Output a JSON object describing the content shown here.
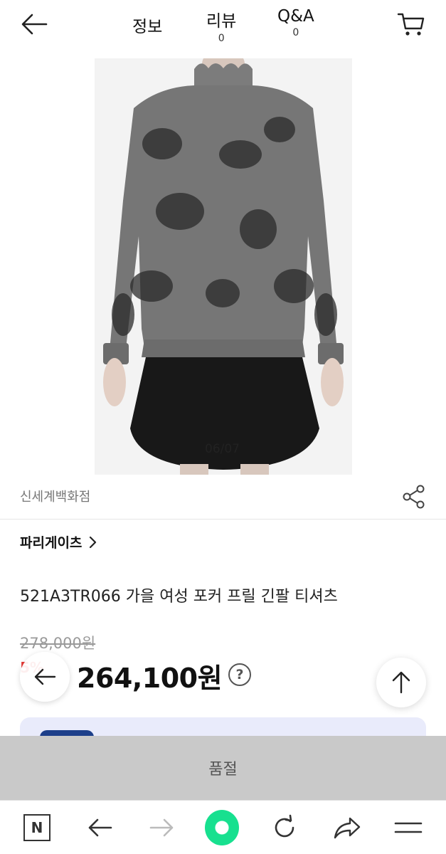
{
  "header": {
    "tabs": [
      {
        "label": "정보",
        "count": ""
      },
      {
        "label": "리뷰",
        "count": "0"
      },
      {
        "label": "Q&A",
        "count": "0"
      }
    ]
  },
  "gallery": {
    "counter": "06/07"
  },
  "store": {
    "name": "신세계백화점"
  },
  "brand": {
    "name": "파리게이츠"
  },
  "product": {
    "title": "521A3TR066 가을 여성 포커 프릴 긴팔 티셔츠",
    "original_price": "278,000원",
    "sale_badge": "5%",
    "price": "264,100원",
    "help_symbol": "?"
  },
  "purchase": {
    "status_label": "품절"
  },
  "browser": {
    "n_label": "N"
  },
  "colors": {
    "accent_green": "#17e08f",
    "sale_red": "#e53935",
    "soldout_bg": "#c9c9c9",
    "promo_bg": "#e9ebfb"
  }
}
